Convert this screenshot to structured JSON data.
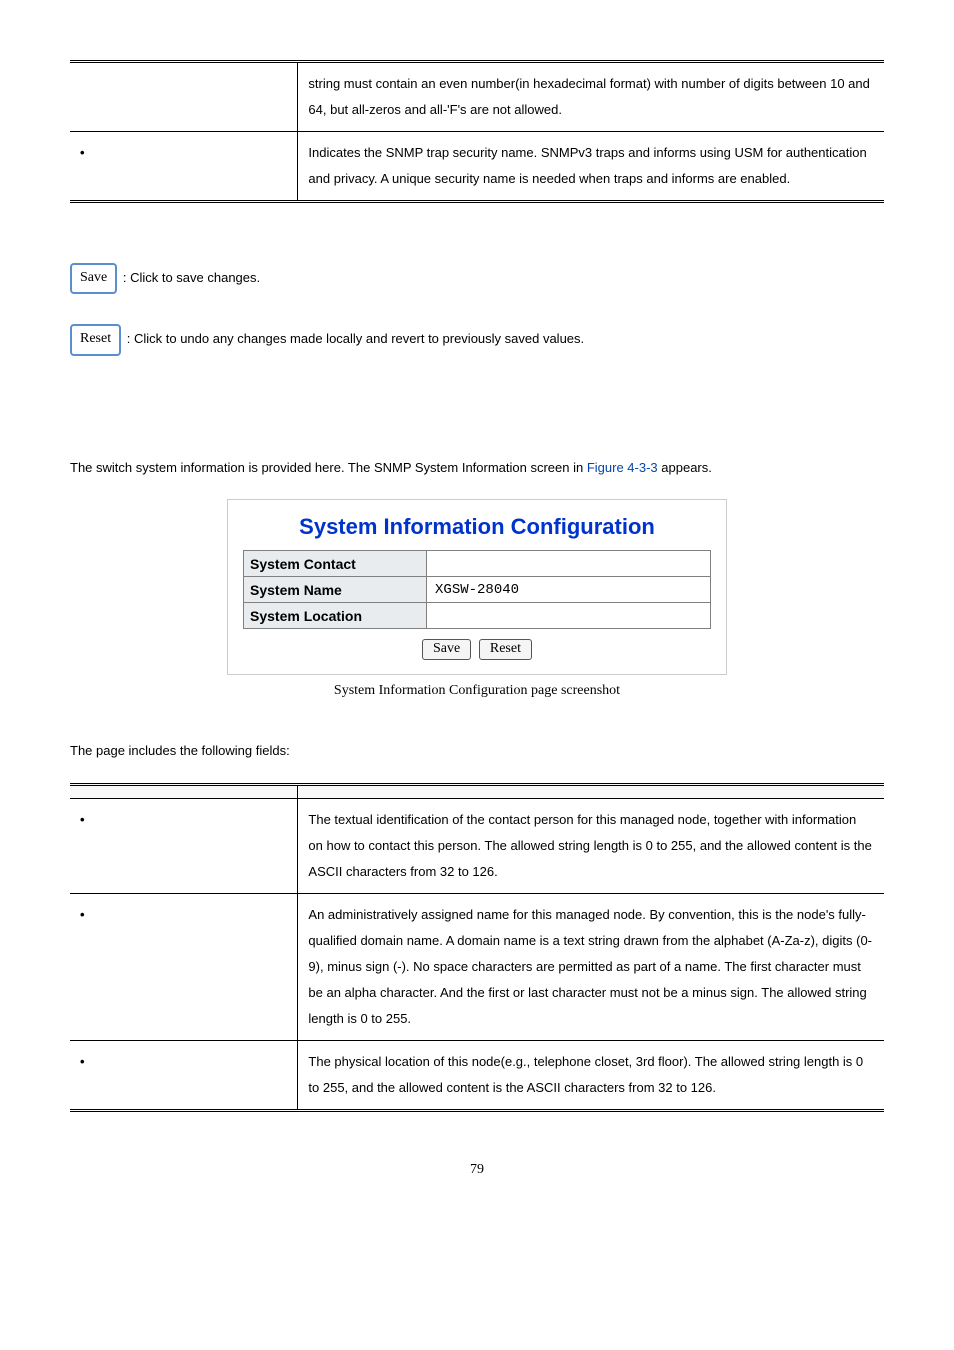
{
  "topTable": {
    "rows": [
      {
        "object": "",
        "description": "string must contain an even number(in hexadecimal format) with number of digits between 10 and 64, but all-zeros and all-'F's are not allowed."
      },
      {
        "object": "",
        "description": "Indicates the SNMP trap security name. SNMPv3 traps and informs using USM for authentication and privacy. A unique security name is needed when traps and informs are enabled."
      }
    ]
  },
  "buttons": {
    "save": {
      "label": "Save",
      "desc": ": Click to save changes."
    },
    "reset": {
      "label": "Reset",
      "desc": ": Click to undo any changes made locally and revert to previously saved values."
    }
  },
  "intro": {
    "prefix": "The switch system information is provided here. The SNMP System Information screen in ",
    "link": "Figure 4-3-3",
    "suffix": " appears."
  },
  "figure": {
    "title": "System Information Configuration",
    "rows": [
      {
        "label": "System Contact",
        "value": ""
      },
      {
        "label": "System Name",
        "value": "XGSW-28040"
      },
      {
        "label": "System Location",
        "value": ""
      }
    ],
    "saveLabel": "Save",
    "resetLabel": "Reset",
    "caption": "System Information Configuration page screenshot"
  },
  "fieldsIntro": "The page includes the following fields:",
  "fieldsTable": {
    "headers": {
      "object": "",
      "description": ""
    },
    "rows": [
      {
        "object": "",
        "description": "The textual identification of the contact person for this managed node, together with information on how to contact this person. The allowed string length is 0 to 255, and the allowed content is the ASCII characters from 32 to 126."
      },
      {
        "object": "",
        "description": "An administratively assigned name for this managed node. By convention, this is the node's fully-qualified domain name. A domain name is a text string drawn from the alphabet (A-Za-z), digits (0-9), minus sign (-). No space characters are permitted as part of a name. The first character must be an alpha character. And the first or last character must not be a minus sign. The allowed string length is 0 to 255."
      },
      {
        "object": "",
        "description": "The physical location of this node(e.g., telephone closet, 3rd floor). The allowed string length is 0 to 255, and the allowed content is the ASCII characters from 32 to 126."
      }
    ]
  },
  "pageNumber": "79"
}
